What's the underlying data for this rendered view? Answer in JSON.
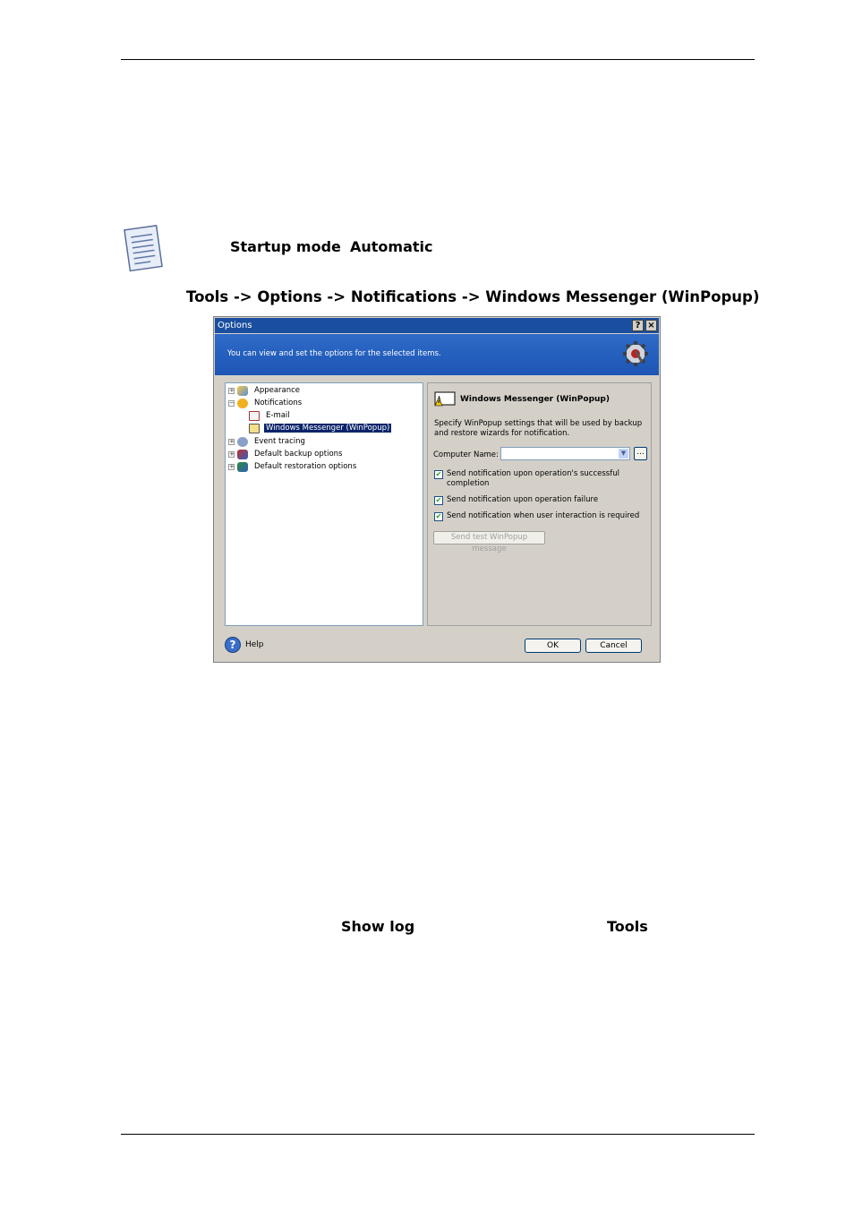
{
  "note": {
    "startup_mode": "Startup mode",
    "automatic": "Automatic"
  },
  "path_heading": "Tools -> Options -> Notifications -> Windows Messenger (WinPopup)",
  "dialog": {
    "title": "Options",
    "help_btn": "?",
    "close_btn": "×",
    "banner_text": "You can view and set the options for the selected items.",
    "tree": [
      {
        "label": "Appearance"
      },
      {
        "label": "Notifications"
      },
      {
        "label": "E-mail"
      },
      {
        "label": "Windows Messenger (WinPopup)"
      },
      {
        "label": "Event tracing"
      },
      {
        "label": "Default backup options"
      },
      {
        "label": "Default restoration options"
      }
    ],
    "panel": {
      "heading": "Windows Messenger (WinPopup)",
      "description": "Specify WinPopup settings that will be used by backup and restore wizards for notification.",
      "computer_name_label": "Computer Name:",
      "computer_name_value": "",
      "browse_label": "...",
      "checkboxes": [
        {
          "label": "Send notification upon operation's successful completion",
          "checked": true
        },
        {
          "label": "Send notification upon operation failure",
          "checked": true
        },
        {
          "label": "Send notification when user interaction is required",
          "checked": true
        }
      ],
      "test_button": "Send test WinPopup message"
    },
    "footer": {
      "help": "Help",
      "ok": "OK",
      "cancel": "Cancel"
    }
  },
  "bottom": {
    "show_log": "Show log",
    "tools": "Tools"
  }
}
